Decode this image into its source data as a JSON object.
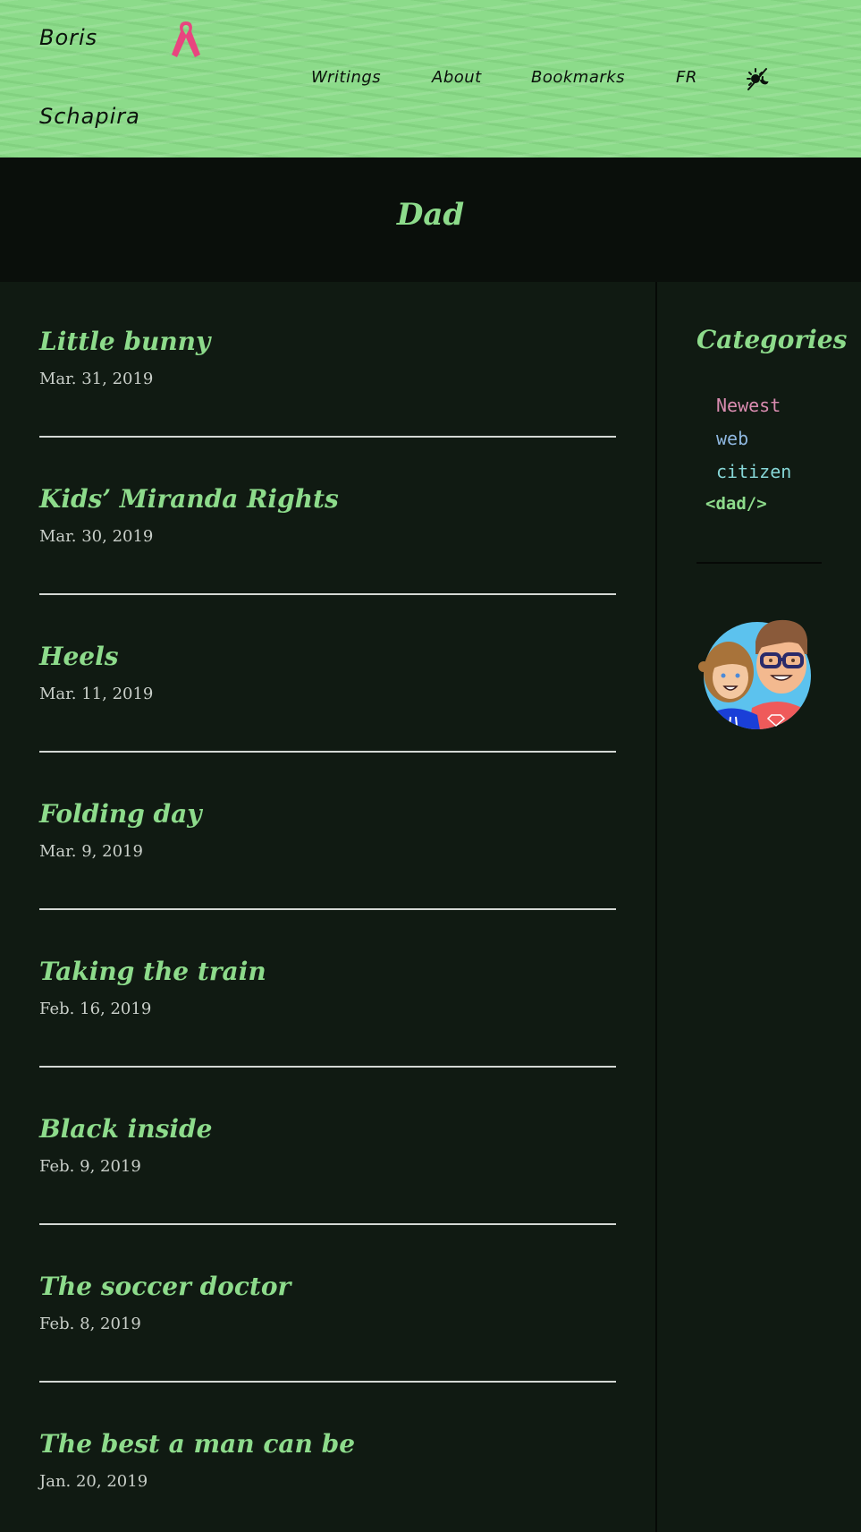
{
  "site": {
    "name_line1": "Boris",
    "name_line2": "Schapira"
  },
  "nav": {
    "items": [
      "Writings",
      "About",
      "Bookmarks",
      "FR"
    ]
  },
  "page": {
    "title": "Dad"
  },
  "posts": [
    {
      "title": "Little bunny",
      "date": "Mar. 31, 2019"
    },
    {
      "title": "Kids’ Miranda Rights",
      "date": "Mar. 30, 2019"
    },
    {
      "title": "Heels",
      "date": "Mar. 11, 2019"
    },
    {
      "title": "Folding day",
      "date": "Mar. 9, 2019"
    },
    {
      "title": "Taking the train",
      "date": "Feb. 16, 2019"
    },
    {
      "title": "Black inside",
      "date": "Feb. 9, 2019"
    },
    {
      "title": "The soccer doctor",
      "date": "Feb. 8, 2019"
    },
    {
      "title": "The best a man can be",
      "date": "Jan. 20, 2019"
    }
  ],
  "sidebar": {
    "title": "Categories",
    "categories": [
      {
        "label": "Newest",
        "color": "#d98cb0"
      },
      {
        "label": "web",
        "color": "#8fb8e0"
      },
      {
        "label": "citizen",
        "color": "#86d6d6"
      },
      {
        "label": "<dad/>",
        "color": "#8ddb8b"
      }
    ]
  },
  "icons": {
    "ribbon": "awareness-ribbon-icon",
    "theme": "theme-toggle-icon",
    "avatar": "father-daughter-avatar"
  },
  "colors": {
    "header_bg": "#8cdb8a",
    "accent": "#8ddb8b",
    "ribbon": "#e8457f",
    "page_bg": "#101a12"
  }
}
